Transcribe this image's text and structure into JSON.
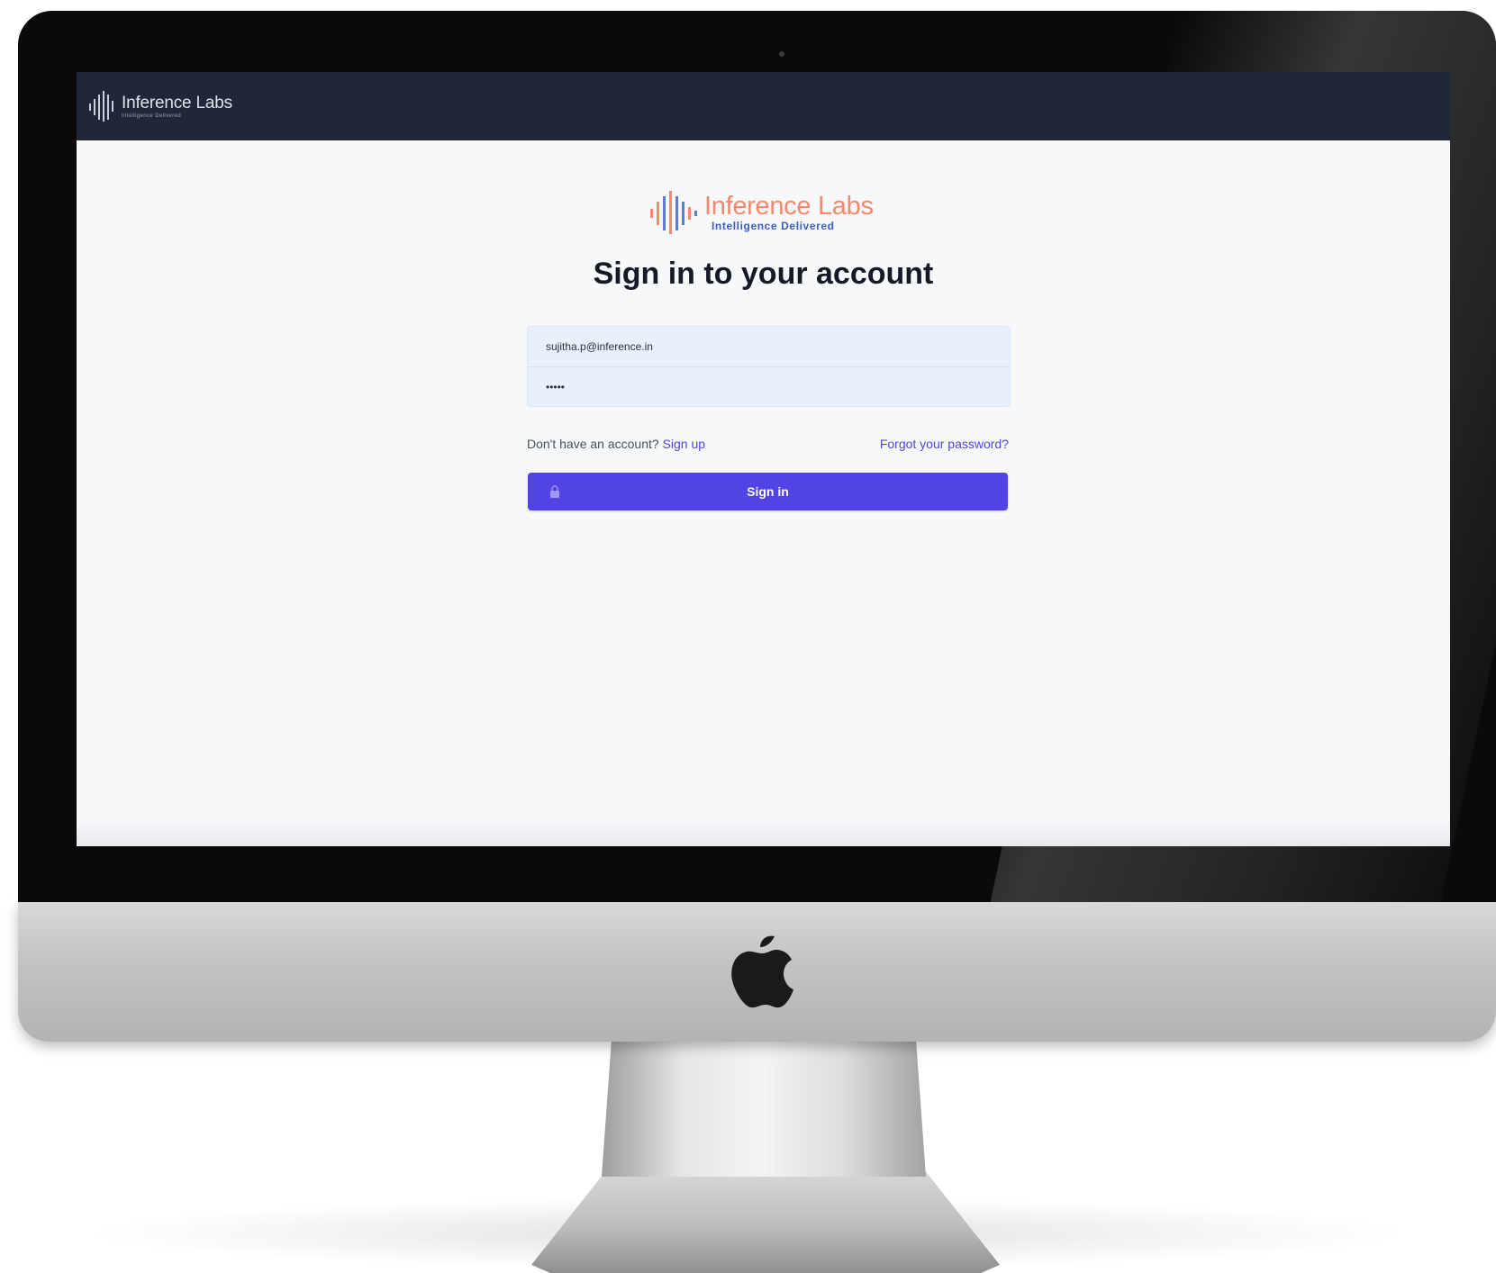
{
  "navbar": {
    "logo_name": "Inference Labs",
    "logo_tagline": "Intelligence Delivered"
  },
  "brand": {
    "name": "Inference Labs",
    "tagline": "Intelligence Delivered",
    "name_color": "#f4896d",
    "tagline_color": "#3b5cc7"
  },
  "signin": {
    "title": "Sign in to your account",
    "email_value": "sujitha.p@inference.in",
    "password_value": "•••••",
    "signup_prompt": "Don't have an account?",
    "signup_link": "Sign up",
    "forgot_link": "Forgot your password?",
    "submit_label": "Sign in",
    "accent_color": "#5143e6"
  },
  "icons": {
    "nav_logo": "inference-labs-logo-icon",
    "brand_logo": "inference-labs-logo-icon",
    "submit": "lock-icon",
    "device": "apple-logo-icon"
  }
}
